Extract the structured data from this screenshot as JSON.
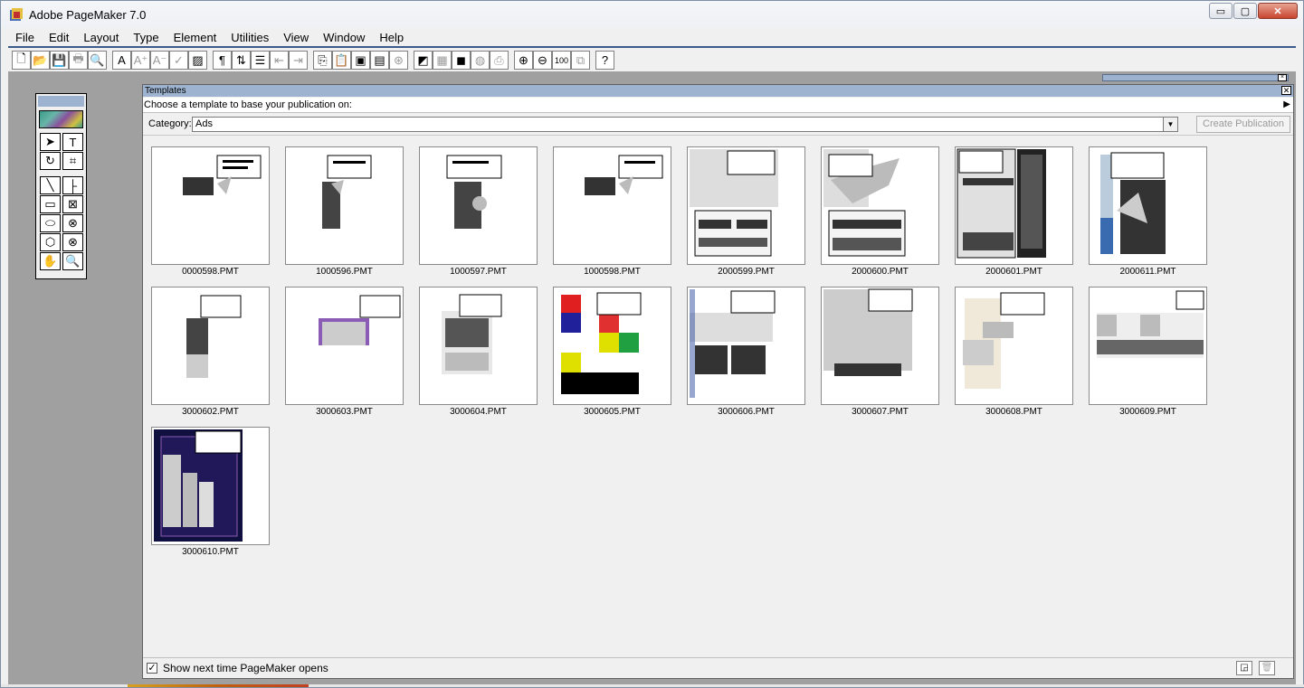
{
  "window": {
    "title": "Adobe PageMaker 7.0",
    "minimize": "▭",
    "maximize": "▢",
    "close": "✕"
  },
  "menu": [
    "File",
    "Edit",
    "Layout",
    "Type",
    "Element",
    "Utilities",
    "View",
    "Window",
    "Help"
  ],
  "toolbar": [
    {
      "icon": "new-document-icon",
      "glyph": "🗋"
    },
    {
      "icon": "open-folder-icon",
      "glyph": "📂"
    },
    {
      "icon": "save-icon",
      "glyph": "💾",
      "dim": true
    },
    {
      "icon": "print-icon",
      "glyph": "🖶",
      "dim": true
    },
    {
      "icon": "find-icon",
      "glyph": "🔍"
    },
    {
      "icon": "character-specs-icon",
      "glyph": "A"
    },
    {
      "icon": "font-size-up-icon",
      "glyph": "A⁺",
      "dim": true
    },
    {
      "icon": "font-size-down-icon",
      "glyph": "A⁻",
      "dim": true
    },
    {
      "icon": "spelling-icon",
      "glyph": "✓",
      "dim": true
    },
    {
      "icon": "fill-icon",
      "glyph": "▨"
    },
    {
      "icon": "paragraph-icon",
      "glyph": "¶"
    },
    {
      "icon": "text-flow-icon",
      "glyph": "⇅"
    },
    {
      "icon": "bullets-icon",
      "glyph": "☰"
    },
    {
      "icon": "indent-left-icon",
      "glyph": "⇤",
      "dim": true
    },
    {
      "icon": "indent-right-icon",
      "glyph": "⇥",
      "dim": true
    },
    {
      "icon": "copy-icon",
      "glyph": "⎘"
    },
    {
      "icon": "paste-icon",
      "glyph": "📋",
      "dim": true
    },
    {
      "icon": "frame-icon",
      "glyph": "▣"
    },
    {
      "icon": "story-editor-icon",
      "glyph": "▤"
    },
    {
      "icon": "link-icon",
      "glyph": "⊛",
      "dim": true
    },
    {
      "icon": "color-palette-icon",
      "glyph": "◩"
    },
    {
      "icon": "image-icon",
      "glyph": "▦",
      "dim": true
    },
    {
      "icon": "photo-icon",
      "glyph": "◼"
    },
    {
      "icon": "globe-icon",
      "glyph": "◍",
      "dim": true
    },
    {
      "icon": "pdf-icon",
      "glyph": "⎙",
      "dim": true
    },
    {
      "icon": "zoom-in-icon",
      "glyph": "⊕"
    },
    {
      "icon": "zoom-out-icon",
      "glyph": "⊖"
    },
    {
      "icon": "actual-size-icon",
      "glyph": "100"
    },
    {
      "icon": "fit-page-icon",
      "glyph": "⧉",
      "dim": true
    },
    {
      "icon": "help-icon",
      "glyph": "?"
    }
  ],
  "toolbox": [
    {
      "name": "pointer-tool-icon",
      "glyph": "➤"
    },
    {
      "name": "text-tool-icon",
      "glyph": "T"
    },
    {
      "name": "rotate-tool-icon",
      "glyph": "↻"
    },
    {
      "name": "crop-tool-icon",
      "glyph": "⌗"
    },
    {
      "name": "line-tool-icon",
      "glyph": "╲"
    },
    {
      "name": "constrained-line-tool-icon",
      "glyph": "├"
    },
    {
      "name": "rectangle-tool-icon",
      "glyph": "▭"
    },
    {
      "name": "rectangle-frame-tool-icon",
      "glyph": "⊠"
    },
    {
      "name": "ellipse-tool-icon",
      "glyph": "⬭"
    },
    {
      "name": "ellipse-frame-tool-icon",
      "glyph": "⊗"
    },
    {
      "name": "polygon-tool-icon",
      "glyph": "⬡"
    },
    {
      "name": "polygon-frame-tool-icon",
      "glyph": "⊗"
    },
    {
      "name": "hand-tool-icon",
      "glyph": "✋"
    },
    {
      "name": "zoom-tool-icon",
      "glyph": "🔍"
    }
  ],
  "templates_panel": {
    "title": "Templates",
    "close": "✕",
    "instruction": "Choose a template to base your publication on:",
    "arrow": "▶",
    "category_label": "Category:",
    "category_value": "Ads",
    "dropdown": "▼",
    "create_button": "Create Publication",
    "templates": [
      {
        "name": "0000598.PMT"
      },
      {
        "name": "1000596.PMT"
      },
      {
        "name": "1000597.PMT"
      },
      {
        "name": "1000598.PMT"
      },
      {
        "name": "2000599.PMT"
      },
      {
        "name": "2000600.PMT"
      },
      {
        "name": "2000601.PMT"
      },
      {
        "name": "2000611.PMT"
      },
      {
        "name": "3000602.PMT"
      },
      {
        "name": "3000603.PMT"
      },
      {
        "name": "3000604.PMT"
      },
      {
        "name": "3000605.PMT"
      },
      {
        "name": "3000606.PMT"
      },
      {
        "name": "3000607.PMT"
      },
      {
        "name": "3000608.PMT"
      },
      {
        "name": "3000609.PMT"
      },
      {
        "name": "3000610.PMT"
      }
    ],
    "show_next_time_checked": "✓",
    "show_next_time_label": "Show next time PageMaker opens",
    "bottom_icons": [
      {
        "name": "new-folder-icon",
        "glyph": "◲"
      },
      {
        "name": "trash-icon",
        "glyph": "🗑"
      }
    ]
  }
}
